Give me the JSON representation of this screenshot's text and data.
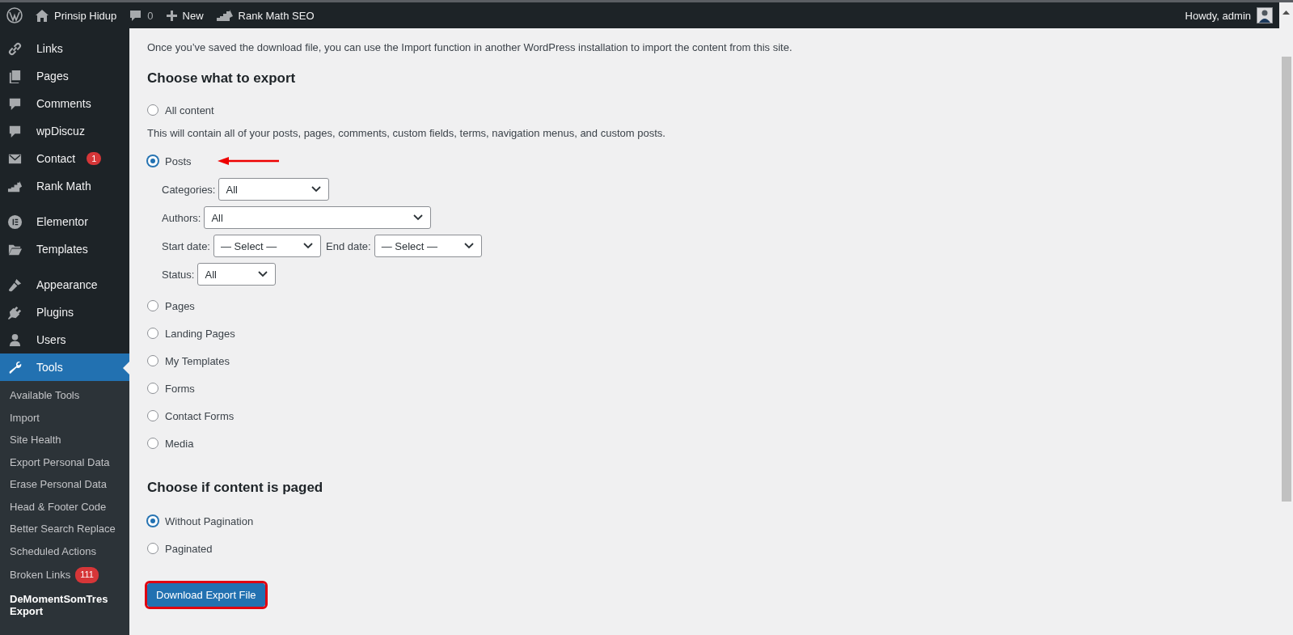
{
  "admin_bar": {
    "site_name": "Prinsip Hidup",
    "comments_count": "0",
    "new_label": "New",
    "seo_label": "Rank Math SEO",
    "greeting": "Howdy, admin"
  },
  "sidebar": {
    "groups": [
      [
        {
          "label": "Links",
          "selected": false
        },
        {
          "label": "Pages",
          "selected": false
        },
        {
          "label": "Comments",
          "selected": false
        },
        {
          "label": "wpDiscuz",
          "selected": false
        },
        {
          "label": "Contact",
          "badge": "1",
          "selected": false
        },
        {
          "label": "Rank Math",
          "selected": false
        }
      ],
      [
        {
          "label": "Elementor",
          "selected": false
        },
        {
          "label": "Templates",
          "selected": false
        }
      ],
      [
        {
          "label": "Appearance",
          "selected": false
        },
        {
          "label": "Plugins",
          "selected": false
        },
        {
          "label": "Users",
          "selected": false
        },
        {
          "label": "Tools",
          "selected": true
        }
      ]
    ],
    "submenu": [
      {
        "label": "Available Tools",
        "selected": false
      },
      {
        "label": "Import",
        "selected": false
      },
      {
        "label": "Site Health",
        "selected": false
      },
      {
        "label": "Export Personal Data",
        "selected": false
      },
      {
        "label": "Erase Personal Data",
        "selected": false
      },
      {
        "label": "Head & Footer Code",
        "selected": false
      },
      {
        "label": "Better Search Replace",
        "selected": false
      },
      {
        "label": "Scheduled Actions",
        "selected": false
      },
      {
        "label": "Broken Links",
        "selected": false,
        "badge": "111"
      },
      {
        "label": "DeMomentSomTres Export",
        "selected": true
      }
    ]
  },
  "content": {
    "intro": "Once you’ve saved the download file, you can use the Import function in another WordPress installation to import the content from this site.",
    "export_heading": "Choose what to export",
    "export_options": [
      {
        "label": "All content",
        "selected": false,
        "description": "This will contain all of your posts, pages, comments, custom fields, terms, navigation menus, and custom posts."
      },
      {
        "label": "Posts",
        "selected": true,
        "annotated": true,
        "filters": [
          [
            {
              "label": "Categories:",
              "value": "All"
            }
          ],
          [
            {
              "label": "Authors:",
              "value": "All"
            }
          ],
          [
            {
              "label": "Start date:",
              "value": "— Select —"
            },
            {
              "label": "End date:",
              "value": "— Select —"
            }
          ],
          [
            {
              "label": "Status:",
              "value": "All"
            }
          ]
        ]
      },
      {
        "label": "Pages",
        "selected": false
      },
      {
        "label": "Landing Pages",
        "selected": false
      },
      {
        "label": "My Templates",
        "selected": false
      },
      {
        "label": "Forms",
        "selected": false
      },
      {
        "label": "Contact Forms",
        "selected": false
      },
      {
        "label": "Media",
        "selected": false
      }
    ],
    "paged_heading": "Choose if content is paged",
    "paged_options": [
      {
        "label": "Without Pagination",
        "selected": true
      },
      {
        "label": "Paginated",
        "selected": false
      }
    ],
    "button": {
      "label": "Download Export File",
      "highlighted": true
    }
  }
}
